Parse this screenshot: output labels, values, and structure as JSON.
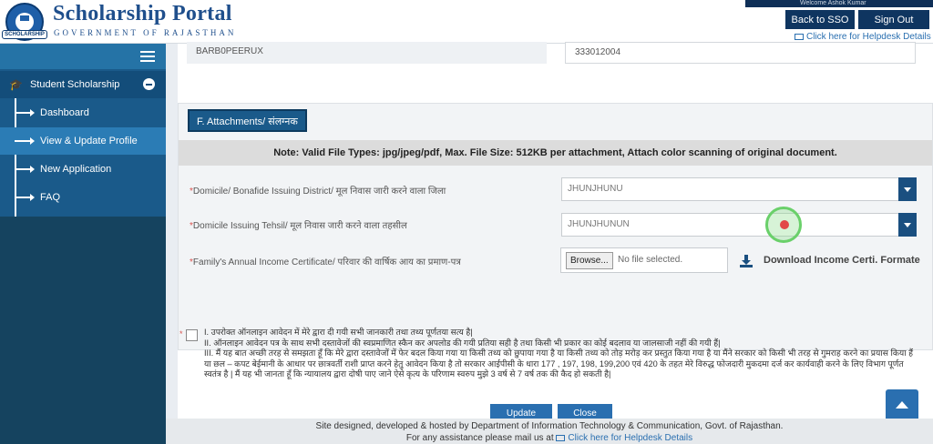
{
  "header": {
    "title": "Scholarship Portal",
    "subtitle": "GOVERNMENT OF RAJASTHAN",
    "seal_text": "SCHOLARSHIP",
    "welcome": "Welcome Ashok Kumar",
    "back_to_sso": "Back to SSO",
    "sign_out": "Sign Out",
    "helpdesk": "Click here for Helpdesk Details"
  },
  "sidebar": {
    "group": "Student Scholarship",
    "items": [
      {
        "label": "Dashboard",
        "active": false
      },
      {
        "label": "View & Update Profile",
        "active": true
      },
      {
        "label": "New Application",
        "active": false
      },
      {
        "label": "FAQ",
        "active": false
      }
    ]
  },
  "top_fields": {
    "left_value": "BARB0PEERUX",
    "right_value": "333012004"
  },
  "attachments": {
    "section_title": "F. Attachments/ संलग्नक",
    "note": "Note: Valid File Types: jpg/jpeg/pdf, Max. File Size: 512KB per attachment, Attach color scanning of original document.",
    "fields": [
      {
        "label": "Domicile/ Bonafide Issuing District/ मूल निवास जारी करने वाला जिला",
        "value": "JHUNJHUNU"
      },
      {
        "label": "Domicile Issuing Tehsil/ मूल निवास जारी करने वाला तहसील",
        "value": "JHUNJHUNUN"
      }
    ],
    "income_label": "Family's Annual Income Certificate/ परिवार की वार्षिक आय का प्रमाण-पत्र",
    "browse_label": "Browse...",
    "file_status": "No file selected.",
    "download_label": "Download Income Certi. Formate"
  },
  "declaration": {
    "lines": [
      "I. उपरोक्त ऑनलाइन आवेदन में मेरे द्वारा दी गयी सभी जानकारी तथा तथ्य पूर्णतया सत्य है|",
      "II. ऑनलाइन आवेदन पत्र के साथ सभी दस्तावेजों की स्वप्रमाणित स्कैन कर अपलोड की गयी प्रतिया सही है तथा किसी भी प्रकार का कोई बदलाव या जालसाजी नहीं की गयी हैं|",
      "III. मैं यह बात अच्छी तरह से समझता हूँ कि मेरे द्वारा दस्तावेजों में फेर बदल किया गया या किसी तथ्य को छुपाया गया है या किसी तथ्य को तोड़ मरोड़ कर प्रस्तुत किया गया है या मैंने सरकार को किसी भी तरह से गुमराह करने का प्रयास किया हैं या छल – कपट बेईमानी के आधार पर छात्रवर्ती राशी प्राप्त करने हेतु आवेदन किया है तो सरकार आईपीसी के धारा 177 , 197, 198, 199,200 एवं 420 के तहत मेरे विरुद्ध फोजदारी मुकदमा दर्ज कर कार्यवाही करने के लिए विभाग पूर्णत स्वतंत्र है | मैं यह भी जानता हूँ कि न्यायालय द्वारा दोषी पाए जाने ऐसे कृत्य के परिणाम स्वरुप मुझे 3 वर्ष से 7 वर्ष तक की कैद हो सकती है|"
    ]
  },
  "actions": {
    "update": "Update",
    "close": "Close"
  },
  "footer": {
    "line1": "Site designed, developed & hosted by Department of Information Technology & Communication, Govt. of Rajasthan.",
    "line2_prefix": "For any assistance please mail us at",
    "line2_link": "Click here for Helpdesk Details"
  }
}
